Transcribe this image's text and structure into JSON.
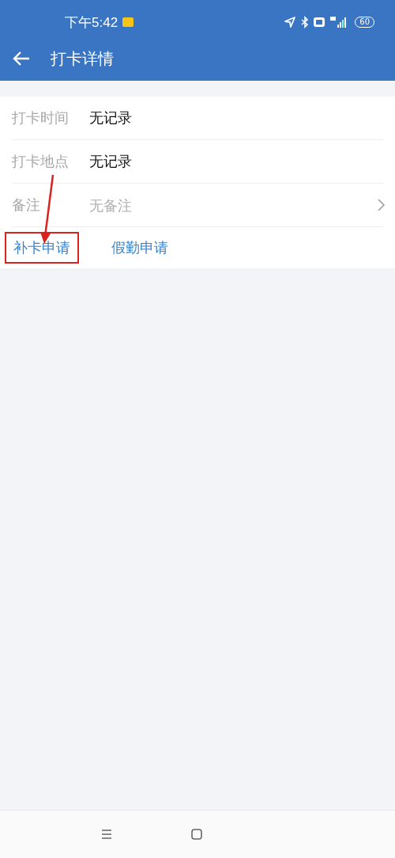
{
  "status_bar": {
    "time": "下午5:42",
    "battery": "60"
  },
  "header": {
    "title": "打卡详情"
  },
  "rows": [
    {
      "label": "打卡时间",
      "value": "无记录",
      "kind": "value"
    },
    {
      "label": "打卡地点",
      "value": "无记录",
      "kind": "value"
    },
    {
      "label": "备注",
      "placeholder": "无备注",
      "kind": "link"
    }
  ],
  "actions": [
    {
      "label": "补卡申请",
      "highlighted": true
    },
    {
      "label": "假勤申请",
      "highlighted": false
    }
  ]
}
